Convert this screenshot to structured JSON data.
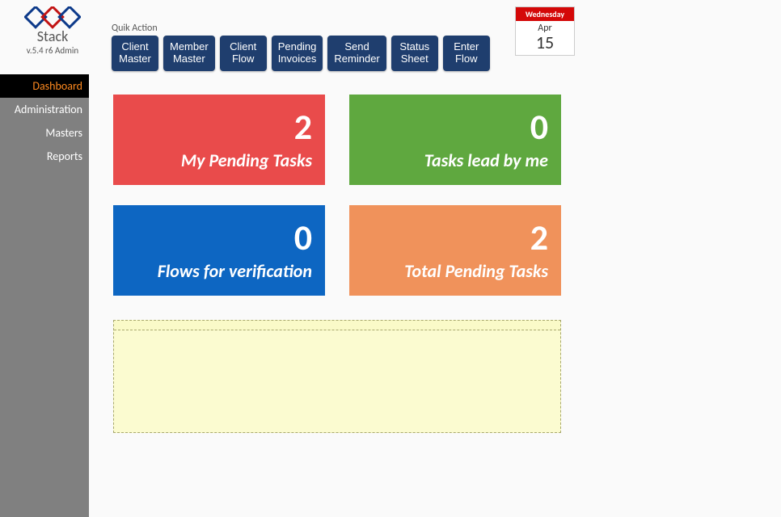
{
  "app": {
    "name": "Stack",
    "version_line": "v.5.4 r6   Admin"
  },
  "quick": {
    "label": "Quik Action",
    "buttons": [
      {
        "l1": "Client",
        "l2": "Master"
      },
      {
        "l1": "Member",
        "l2": "Master"
      },
      {
        "l1": "Client",
        "l2": "Flow"
      },
      {
        "l1": "Pending",
        "l2": "Invoices"
      },
      {
        "l1": "Send",
        "l2": "Reminder"
      },
      {
        "l1": "Status",
        "l2": "Sheet"
      },
      {
        "l1": "Enter",
        "l2": "Flow"
      }
    ]
  },
  "date": {
    "weekday": "Wednesday",
    "month": "Apr",
    "day": "15"
  },
  "sidebar": {
    "items": [
      {
        "label": "Dashboard",
        "active": true
      },
      {
        "label": "Administration",
        "active": false
      },
      {
        "label": "Masters",
        "active": false
      },
      {
        "label": "Reports",
        "active": false
      }
    ]
  },
  "cards": [
    {
      "value": "2",
      "label": "My Pending Tasks",
      "color": "red"
    },
    {
      "value": "0",
      "label": "Tasks lead by me",
      "color": "green"
    },
    {
      "value": "0",
      "label": "Flows for verification",
      "color": "blue"
    },
    {
      "value": "2",
      "label": "Total Pending Tasks",
      "color": "orange"
    }
  ],
  "notes": {
    "content": ""
  }
}
